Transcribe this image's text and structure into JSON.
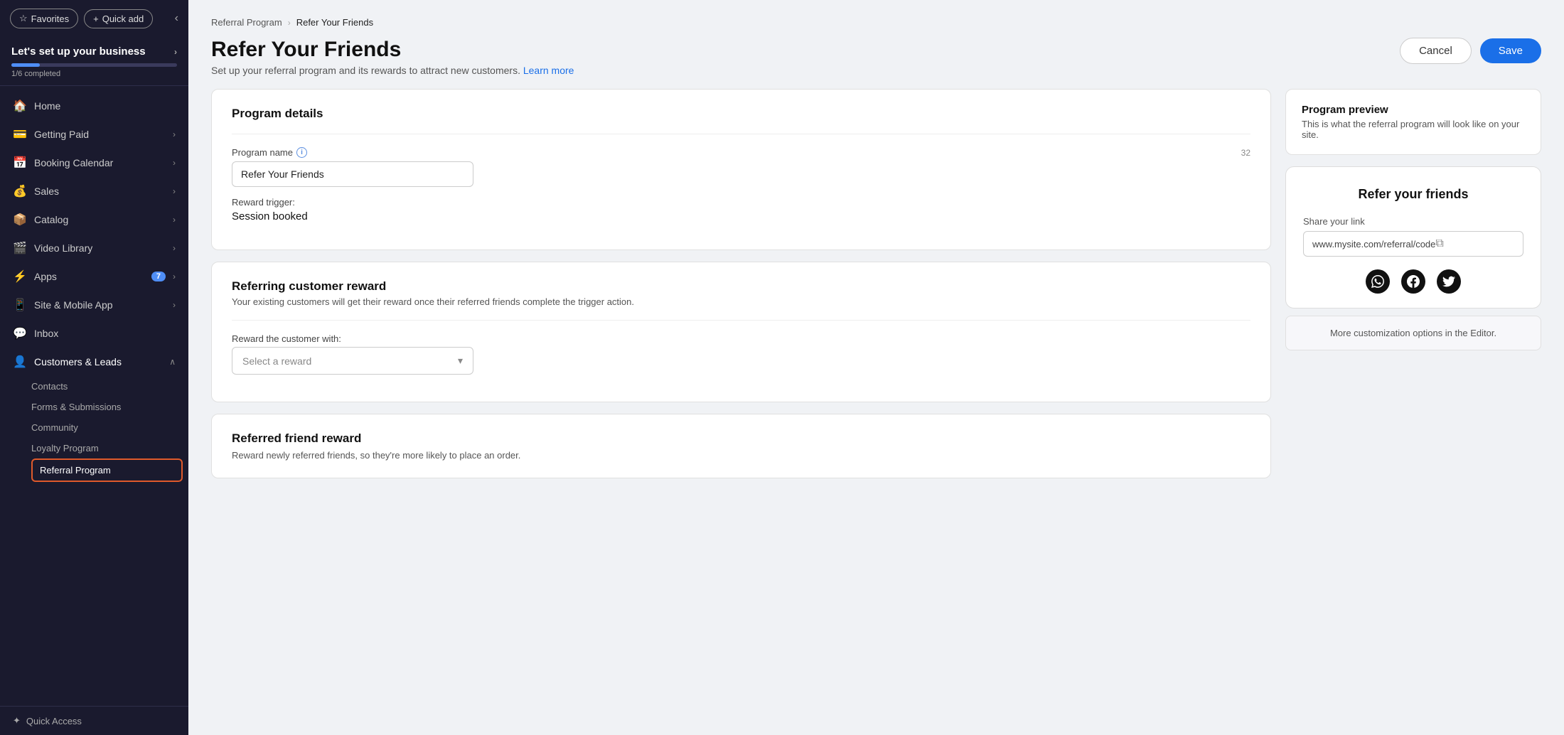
{
  "sidebar": {
    "favorites_label": "Favorites",
    "quick_add_label": "Quick add",
    "business_title": "Let's set up your business",
    "progress_percent": 17,
    "progress_label": "1/6 completed",
    "nav_items": [
      {
        "id": "home",
        "icon": "🏠",
        "label": "Home",
        "has_arrow": false
      },
      {
        "id": "getting-paid",
        "icon": "💳",
        "label": "Getting Paid",
        "has_arrow": true
      },
      {
        "id": "booking",
        "icon": "📅",
        "label": "Booking Calendar",
        "has_arrow": true
      },
      {
        "id": "sales",
        "icon": "💰",
        "label": "Sales",
        "has_arrow": true
      },
      {
        "id": "catalog",
        "icon": "📦",
        "label": "Catalog",
        "has_arrow": true
      },
      {
        "id": "video",
        "icon": "🎬",
        "label": "Video Library",
        "has_arrow": true
      },
      {
        "id": "apps",
        "icon": "⚡",
        "label": "Apps",
        "badge": "7",
        "has_arrow": true
      },
      {
        "id": "site",
        "icon": "📱",
        "label": "Site & Mobile App",
        "has_arrow": true
      },
      {
        "id": "inbox",
        "icon": "💬",
        "label": "Inbox",
        "has_arrow": false
      },
      {
        "id": "customers",
        "icon": "👤",
        "label": "Customers & Leads",
        "has_arrow": true,
        "expanded": true
      }
    ],
    "sub_items": [
      {
        "id": "contacts",
        "label": "Contacts",
        "active": false
      },
      {
        "id": "forms",
        "label": "Forms & Submissions",
        "active": false
      },
      {
        "id": "community",
        "label": "Community",
        "active": false
      },
      {
        "id": "loyalty",
        "label": "Loyalty Program",
        "active": false
      },
      {
        "id": "referral",
        "label": "Referral Program",
        "active": true
      }
    ],
    "quick_access_label": "Quick Access"
  },
  "breadcrumb": {
    "parent": "Referral Program",
    "current": "Refer Your Friends"
  },
  "page": {
    "title": "Refer Your Friends",
    "subtitle": "Set up your referral program and its rewards to attract new customers.",
    "learn_more": "Learn more",
    "cancel_label": "Cancel",
    "save_label": "Save"
  },
  "program_details": {
    "section_title": "Program details",
    "name_label": "Program name",
    "name_char_count": "32",
    "name_value": "Refer Your Friends",
    "trigger_label": "Reward trigger:",
    "trigger_value": "Session booked"
  },
  "referring_reward": {
    "section_title": "Referring customer reward",
    "description": "Your existing customers will get their reward once their referred friends complete the trigger action.",
    "reward_label": "Reward the customer with:",
    "reward_placeholder": "Select a reward"
  },
  "referred_reward": {
    "section_title": "Referred friend reward",
    "description": "Reward newly referred friends, so they're more likely to place an order."
  },
  "preview": {
    "title": "Program preview",
    "description": "This is what the referral program will look like on your site.",
    "widget_title": "Refer your friends",
    "link_label": "Share your link",
    "link_value": "www.mysite.com/referral/code",
    "editor_note": "More customization options in the Editor."
  }
}
